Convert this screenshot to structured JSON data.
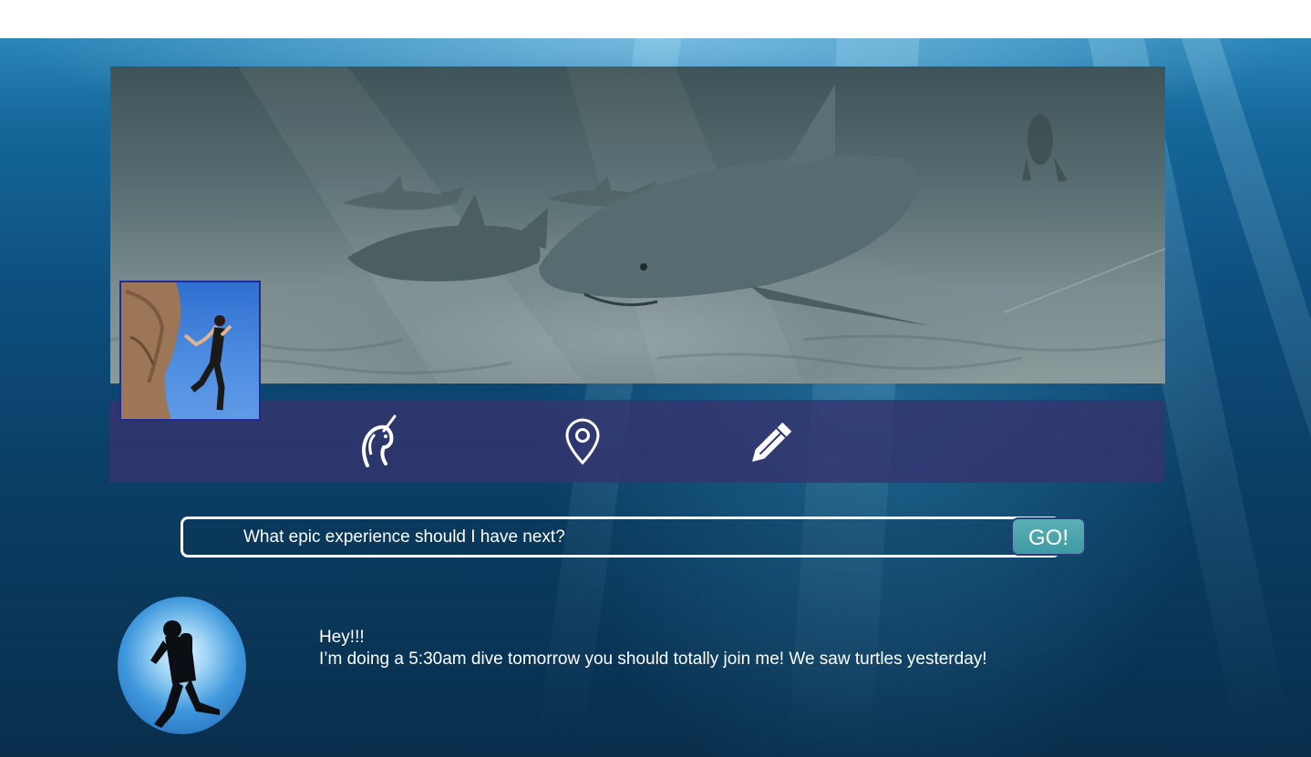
{
  "page": {
    "background_color": "#ffffff",
    "ocean_color": "#0d4f7e",
    "accent_color": "#3f9aa3",
    "nav_color": "#34346e"
  },
  "banner": {
    "image": "shark-underwater-photo"
  },
  "profile": {
    "avatar": "rock-climber-photo"
  },
  "nav": {
    "icons": [
      "unicorn-icon",
      "map-pin-icon",
      "pencil-icon"
    ]
  },
  "search": {
    "placeholder": "What epic experience should I have next?",
    "button_label": "GO!"
  },
  "message": {
    "avatar": "scuba-diver-photo",
    "greeting": "Hey!!!",
    "body": "I’m doing a 5:30am dive tomorrow you should totally join me! We saw turtles yesterday!"
  }
}
